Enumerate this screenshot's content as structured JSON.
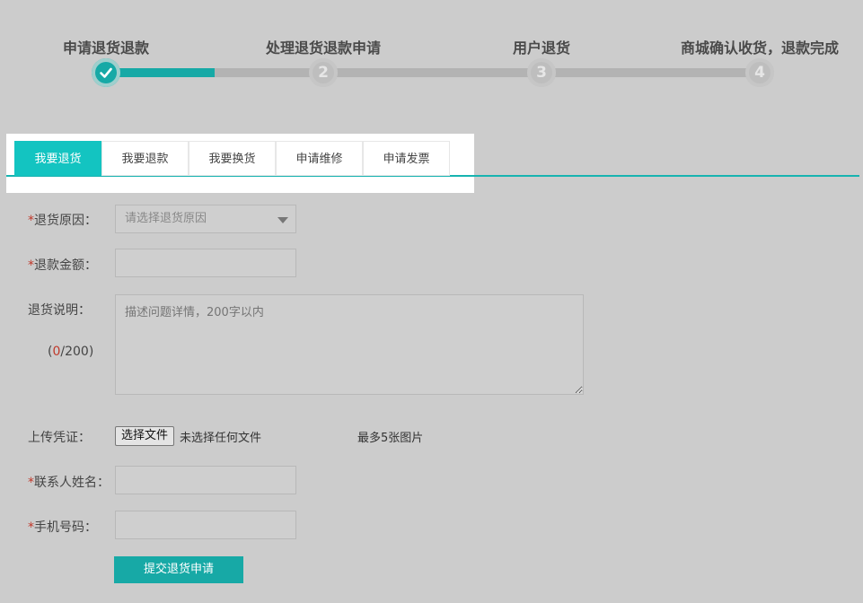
{
  "steps": [
    {
      "label": "申请退货退款",
      "number": "1",
      "status": "done"
    },
    {
      "label": "处理退货退款申请",
      "number": "2",
      "status": "pending"
    },
    {
      "label": "用户退货",
      "number": "3",
      "status": "pending"
    },
    {
      "label": "商城确认收货，退款完成",
      "number": "4",
      "status": "pending"
    }
  ],
  "tabs": [
    {
      "label": "我要退货",
      "active": true
    },
    {
      "label": "我要退款",
      "active": false
    },
    {
      "label": "我要换货",
      "active": false
    },
    {
      "label": "申请维修",
      "active": false
    },
    {
      "label": "申请发票",
      "active": false
    }
  ],
  "form": {
    "required_mark": "*",
    "reason": {
      "label": "退货原因：",
      "placeholder": "请选择退货原因"
    },
    "amount": {
      "label": "退款金额：",
      "value": ""
    },
    "description": {
      "label": "退货说明：",
      "placeholder": "描述问题详情，200字以内",
      "count_open": "(",
      "count": "0",
      "count_max": "/200)"
    },
    "upload": {
      "label": "上传凭证：",
      "button_label": "选择文件",
      "status": "未选择任何文件",
      "hint": "最多5张图片"
    },
    "contact_name": {
      "label": "联系人姓名：",
      "value": ""
    },
    "phone": {
      "label": "手机号码：",
      "value": ""
    },
    "submit_label": "提交退货申请"
  },
  "colors": {
    "accent": "#17a9a6",
    "tab_active": "#13c4c1",
    "required": "#c0392b",
    "background": "#cccccc"
  }
}
